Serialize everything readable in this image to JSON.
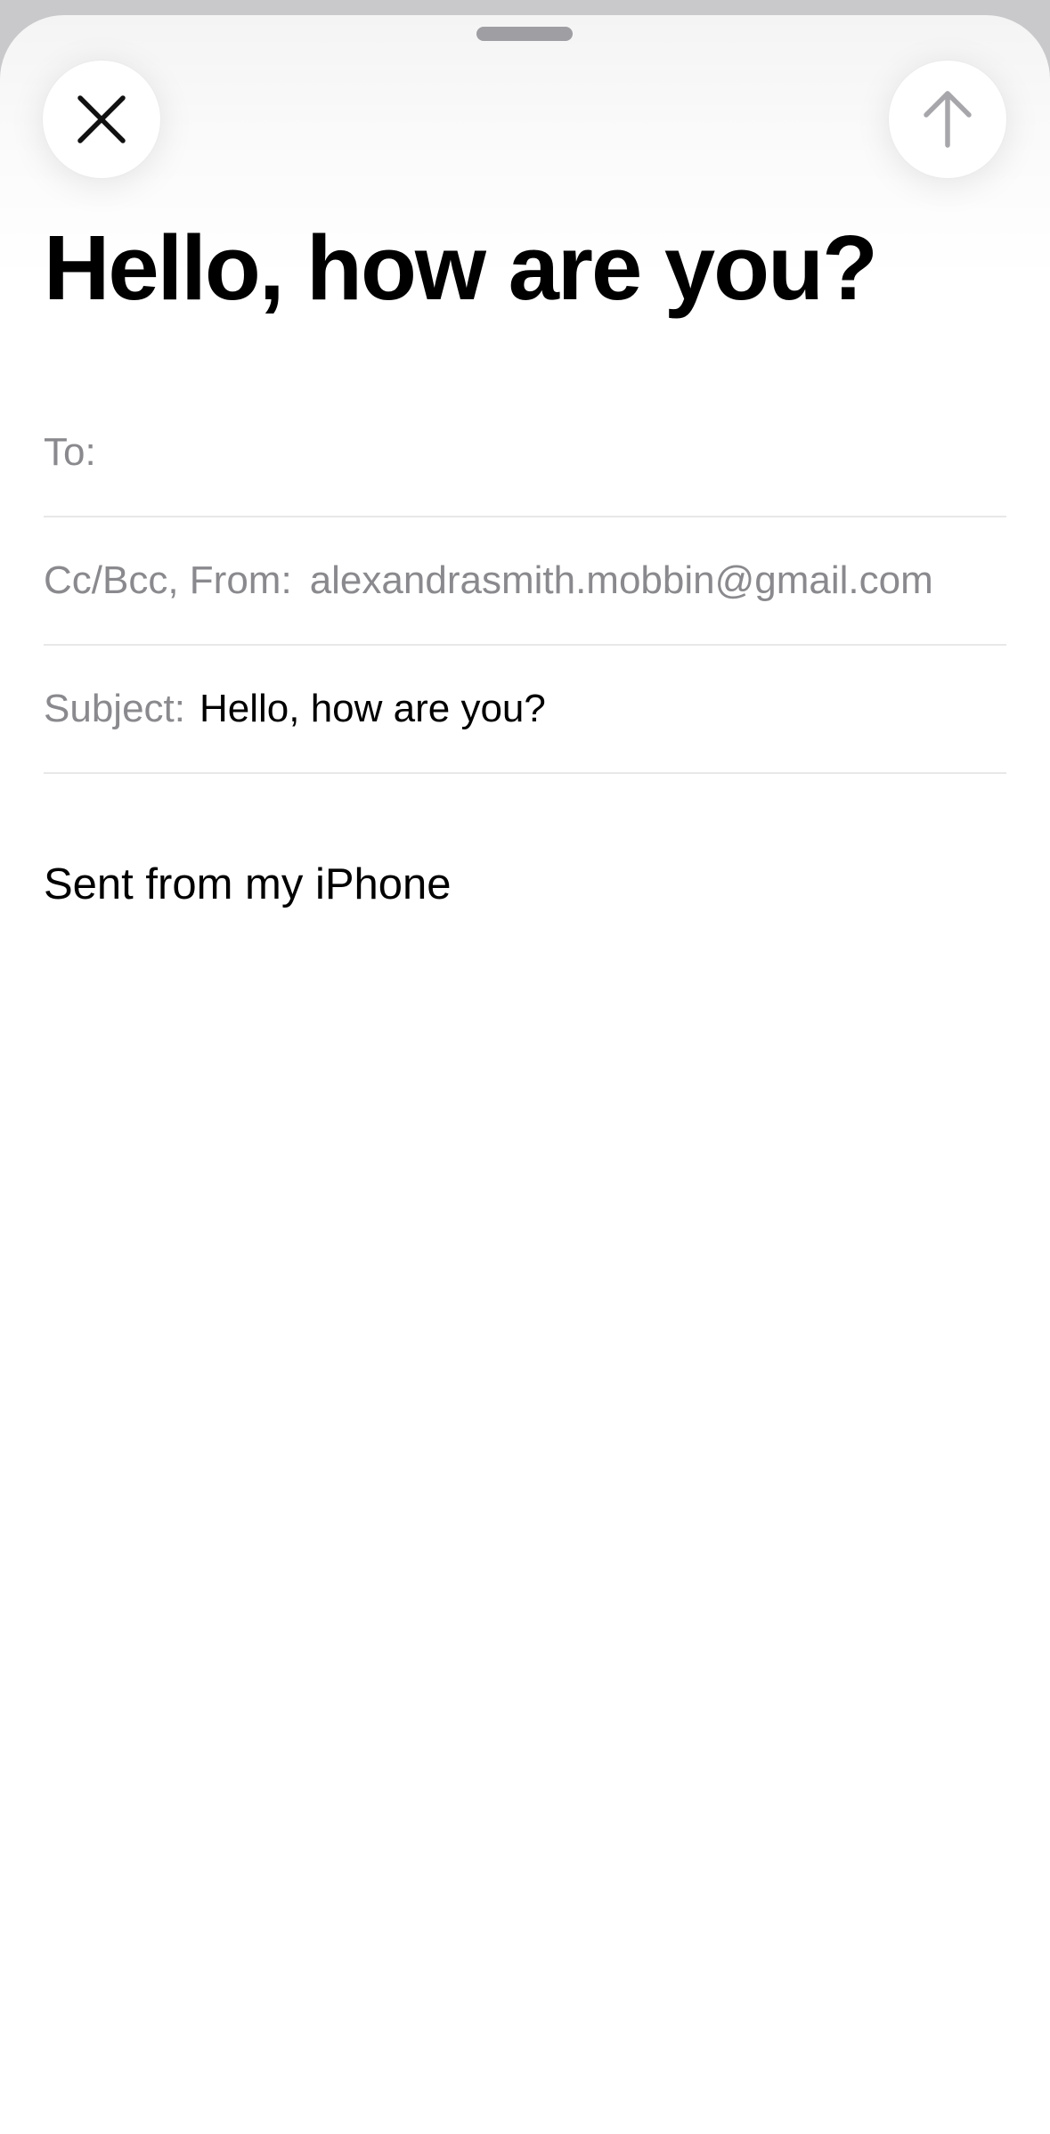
{
  "compose": {
    "title": "Hello, how are you?",
    "close_icon": "close-icon",
    "send_icon": "arrow-up-icon",
    "to_label": "To:",
    "to_value": "",
    "cc_from_label": "Cc/Bcc, From:",
    "from_email": "alexandrasmith.mobbin@gmail.com",
    "subject_label": "Subject:",
    "subject_value": "Hello, how are you?",
    "body_text": "Sent from my iPhone"
  },
  "colors": {
    "label_gray": "#8a8a8e",
    "send_disabled": "#a7a7ab",
    "text": "#000000"
  }
}
